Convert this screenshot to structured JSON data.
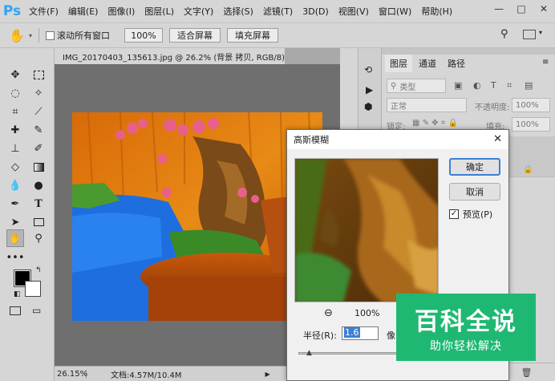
{
  "app": {
    "logo": "Ps"
  },
  "menu": [
    "文件(F)",
    "编辑(E)",
    "图像(I)",
    "图层(L)",
    "文字(Y)",
    "选择(S)",
    "滤镜(T)",
    "3D(D)",
    "视图(V)",
    "窗口(W)",
    "帮助(H)"
  ],
  "window_controls": {
    "minimize": "—",
    "maximize": "□",
    "close": "✕"
  },
  "options": {
    "scroll_all_label": "滚动所有窗口",
    "zoom_value": "100%",
    "fit_screen": "适合屏幕",
    "fill_screen": "填充屏幕"
  },
  "document": {
    "tab_title": "IMG_20170403_135613.jpg @ 26.2% (背景 拷贝, RGB/8) *",
    "tab_close": "×",
    "zoom": "26.15%",
    "doc_info": "文档:4.57M/10.4M"
  },
  "layers_panel": {
    "tabs": [
      "图层",
      "通道",
      "路径"
    ],
    "filter_kind": "类型",
    "blend_mode": "正常",
    "opacity_label": "不透明度:",
    "opacity_value": "100%",
    "lock_label": "锁定:",
    "fill_label": "填充:",
    "fill_value": "100%"
  },
  "dialog": {
    "title": "高斯模糊",
    "ok": "确定",
    "cancel": "取消",
    "preview_label": "预览(P)",
    "zoom_value": "100%",
    "radius_label": "半径(R):",
    "radius_value": "1.6",
    "unit": "像"
  },
  "watermark": {
    "title": "百科全说",
    "subtitle": "助你轻松解决"
  },
  "colors": {
    "accent": "#2fa3f6",
    "watermark_bg": "#1fb872"
  }
}
